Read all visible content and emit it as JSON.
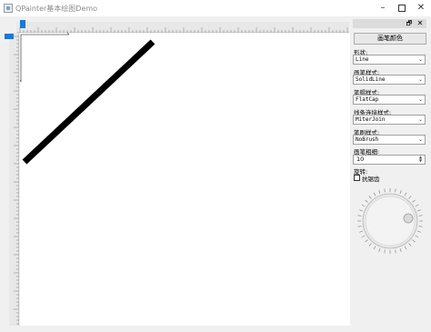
{
  "window": {
    "title": "QPainter基本绘图Demo",
    "minimize_glyph": "–",
    "close_glyph": "✕"
  },
  "dock": {
    "float_glyph": "🗗",
    "close_glyph": "✕"
  },
  "controls": {
    "pen_color_button": "画笔颜色",
    "shape_label": "形状:",
    "shape_value": "Line",
    "pen_style_label": "画笔样式:",
    "pen_style_value": "SolidLine",
    "cap_style_label": "笔帽样式:",
    "cap_style_value": "FlatCap",
    "join_style_label": "线条连接样式:",
    "join_style_value": "MiterJoin",
    "brush_style_label": "笔刷样式:",
    "brush_style_value": "NoBrush",
    "pen_width_label": "画笔粗细:",
    "pen_width_value": "10",
    "rotation_label": "旋转:",
    "antialias_label": "抗锯齿",
    "antialias_checked": false,
    "combo_arrow_glyph": "⌄",
    "spin_up_glyph": "▲",
    "spin_down_glyph": "▼"
  },
  "colors": {
    "ruler_marker": "#1e78d0",
    "canvas": "#ffffff",
    "line": "#000000"
  }
}
